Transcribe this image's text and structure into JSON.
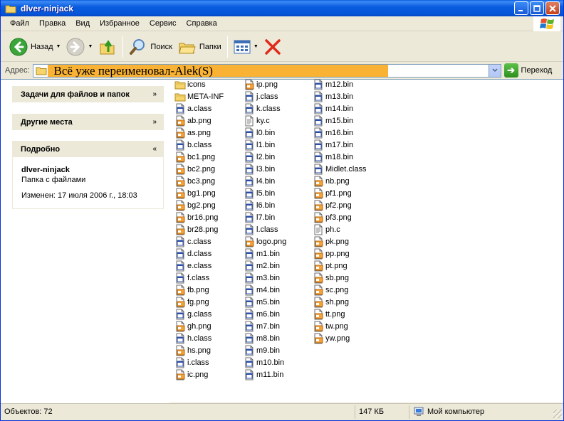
{
  "window": {
    "title": "dlver-ninjack"
  },
  "menu": [
    {
      "label": "Файл"
    },
    {
      "label": "Правка"
    },
    {
      "label": "Вид"
    },
    {
      "label": "Избранное"
    },
    {
      "label": "Сервис"
    },
    {
      "label": "Справка"
    }
  ],
  "toolbar": {
    "back_label": "Назад",
    "search_label": "Поиск",
    "folders_label": "Папки"
  },
  "address": {
    "label": "Адрес:",
    "value": "Всё уже переименовал-Alek(S)",
    "go_label": "Переход",
    "highlight_color": "#f9b233"
  },
  "tasks": {
    "file_tasks_title": "Задачи для файлов и папок",
    "other_places_title": "Другие места",
    "details_title": "Подробно",
    "details_name": "dlver-ninjack",
    "details_type": "Папка с файлами",
    "details_modified": "Изменен: 17 июля 2006 г., 18:03"
  },
  "files": {
    "col1": [
      {
        "name": "icons",
        "type": "folder"
      },
      {
        "name": "META-INF",
        "type": "folder"
      },
      {
        "name": "a.class",
        "type": "class"
      },
      {
        "name": "ab.png",
        "type": "png"
      },
      {
        "name": "as.png",
        "type": "png"
      },
      {
        "name": "b.class",
        "type": "class"
      },
      {
        "name": "bc1.png",
        "type": "png"
      },
      {
        "name": "bc2.png",
        "type": "png"
      },
      {
        "name": "bc3.png",
        "type": "png"
      },
      {
        "name": "bg1.png",
        "type": "png"
      },
      {
        "name": "bg2.png",
        "type": "png"
      },
      {
        "name": "br16.png",
        "type": "png"
      },
      {
        "name": "br28.png",
        "type": "png"
      },
      {
        "name": "c.class",
        "type": "class"
      },
      {
        "name": "d.class",
        "type": "class"
      },
      {
        "name": "e.class",
        "type": "class"
      },
      {
        "name": "f.class",
        "type": "class"
      },
      {
        "name": "fb.png",
        "type": "png"
      },
      {
        "name": "fg.png",
        "type": "png"
      },
      {
        "name": "g.class",
        "type": "class"
      },
      {
        "name": "gh.png",
        "type": "png"
      },
      {
        "name": "h.class",
        "type": "class"
      },
      {
        "name": "hs.png",
        "type": "png"
      },
      {
        "name": "i.class",
        "type": "class"
      },
      {
        "name": "ic.png",
        "type": "png"
      }
    ],
    "col2": [
      {
        "name": "ip.png",
        "type": "png"
      },
      {
        "name": "j.class",
        "type": "class"
      },
      {
        "name": "k.class",
        "type": "class"
      },
      {
        "name": "ky.c",
        "type": "c"
      },
      {
        "name": "l0.bin",
        "type": "bin"
      },
      {
        "name": "l1.bin",
        "type": "bin"
      },
      {
        "name": "l2.bin",
        "type": "bin"
      },
      {
        "name": "l3.bin",
        "type": "bin"
      },
      {
        "name": "l4.bin",
        "type": "bin"
      },
      {
        "name": "l5.bin",
        "type": "bin"
      },
      {
        "name": "l6.bin",
        "type": "bin"
      },
      {
        "name": "l7.bin",
        "type": "bin"
      },
      {
        "name": "l.class",
        "type": "class"
      },
      {
        "name": "logo.png",
        "type": "png"
      },
      {
        "name": "m1.bin",
        "type": "bin"
      },
      {
        "name": "m2.bin",
        "type": "bin"
      },
      {
        "name": "m3.bin",
        "type": "bin"
      },
      {
        "name": "m4.bin",
        "type": "bin"
      },
      {
        "name": "m5.bin",
        "type": "bin"
      },
      {
        "name": "m6.bin",
        "type": "bin"
      },
      {
        "name": "m7.bin",
        "type": "bin"
      },
      {
        "name": "m8.bin",
        "type": "bin"
      },
      {
        "name": "m9.bin",
        "type": "bin"
      },
      {
        "name": "m10.bin",
        "type": "bin"
      },
      {
        "name": "m11.bin",
        "type": "bin"
      }
    ],
    "col3": [
      {
        "name": "m12.bin",
        "type": "bin"
      },
      {
        "name": "m13.bin",
        "type": "bin"
      },
      {
        "name": "m14.bin",
        "type": "bin"
      },
      {
        "name": "m15.bin",
        "type": "bin"
      },
      {
        "name": "m16.bin",
        "type": "bin"
      },
      {
        "name": "m17.bin",
        "type": "bin"
      },
      {
        "name": "m18.bin",
        "type": "bin"
      },
      {
        "name": "Midlet.class",
        "type": "class"
      },
      {
        "name": "nb.png",
        "type": "png"
      },
      {
        "name": "pf1.png",
        "type": "png"
      },
      {
        "name": "pf2.png",
        "type": "png"
      },
      {
        "name": "pf3.png",
        "type": "png"
      },
      {
        "name": "ph.c",
        "type": "c"
      },
      {
        "name": "pk.png",
        "type": "png"
      },
      {
        "name": "pp.png",
        "type": "png"
      },
      {
        "name": "pt.png",
        "type": "png"
      },
      {
        "name": "sb.png",
        "type": "png"
      },
      {
        "name": "sc.png",
        "type": "png"
      },
      {
        "name": "sh.png",
        "type": "png"
      },
      {
        "name": "tt.png",
        "type": "png"
      },
      {
        "name": "tw.png",
        "type": "png"
      },
      {
        "name": "yw.png",
        "type": "png"
      }
    ]
  },
  "status": {
    "objects": "Объектов: 72",
    "size": "147 КБ",
    "location": "Мой компьютер"
  },
  "icons": {
    "folder": "folder-icon",
    "class": "class-file-icon",
    "png": "png-file-icon",
    "bin": "bin-file-icon",
    "c": "c-file-icon"
  }
}
